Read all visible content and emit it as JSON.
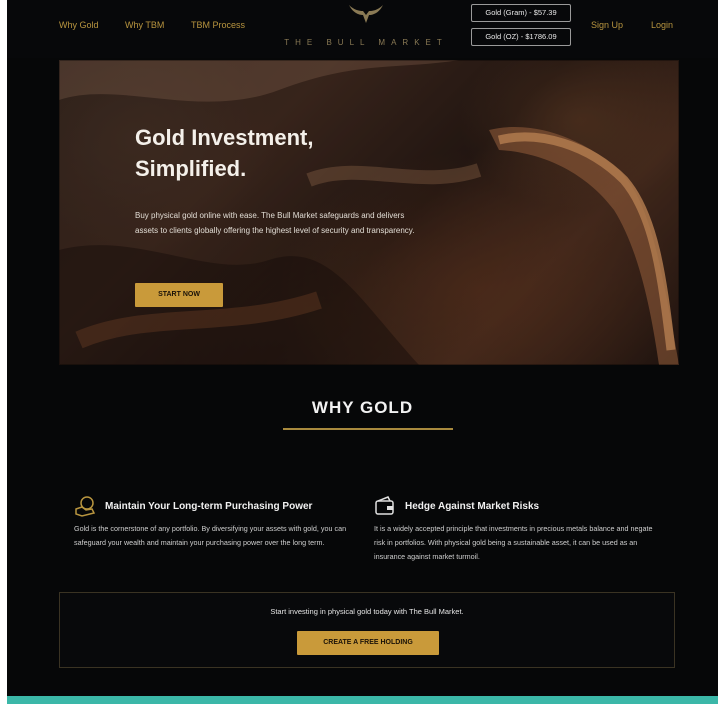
{
  "nav": {
    "links": [
      "Why Gold",
      "Why TBM",
      "TBM Process"
    ],
    "brand": "THE BULL MARKET",
    "prices": [
      "Gold (Gram) - $57.39",
      "Gold (OZ) - $1786.09"
    ],
    "signup": "Sign Up",
    "login": "Login"
  },
  "hero": {
    "title_line1": "Gold Investment,",
    "title_line2": "Simplified.",
    "text": "Buy physical gold online with ease. The Bull Market safeguards and delivers assets to clients globally offering the highest level of security and transparency.",
    "cta": "START NOW"
  },
  "why": {
    "heading": "WHY GOLD",
    "features": [
      {
        "icon": "shield-coin-icon",
        "title": "Maintain Your Long-term Purchasing Power",
        "text": "Gold is the cornerstone of any portfolio. By diversifying your assets with gold, you can safeguard your wealth and maintain your purchasing power over the long term."
      },
      {
        "icon": "wallet-icon",
        "title": "Hedge Against Market Risks",
        "text": "It is a widely accepted principle that investments in precious metals balance and negate risk in portfolios. With physical gold being a sustainable asset, it can be used as an insurance against market turmoil."
      }
    ]
  },
  "cta": {
    "text": "Start investing in physical gold today with The Bull Market.",
    "button": "CREATE A FREE HOLDING"
  },
  "colors": {
    "gold": "#c99a3a",
    "background": "#060708",
    "footer_accent": "#3bb7a8"
  }
}
